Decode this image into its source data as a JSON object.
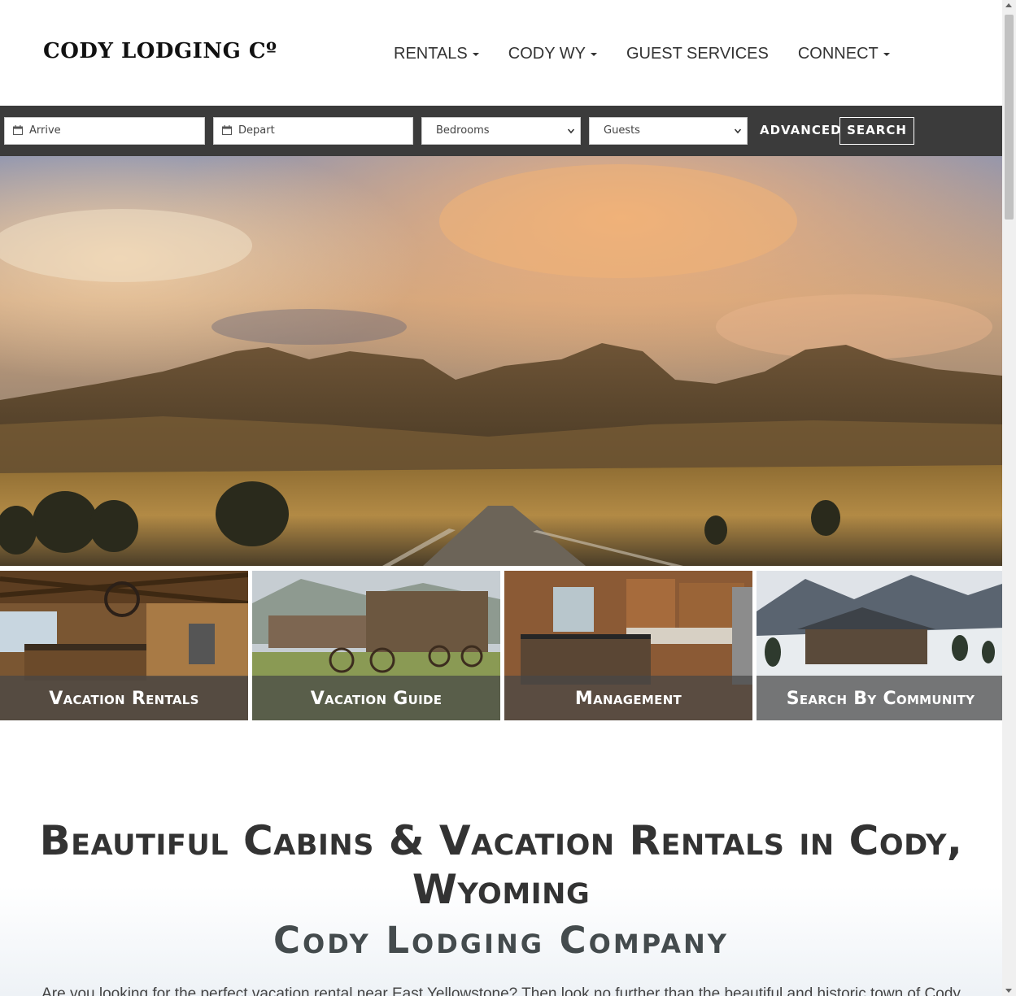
{
  "brand": {
    "logo_text": "CODY LODGING Cº"
  },
  "nav": {
    "items": [
      {
        "label": "RENTALS",
        "dropdown": true
      },
      {
        "label": "CODY WY",
        "dropdown": true
      },
      {
        "label": "GUEST SERVICES",
        "dropdown": false
      },
      {
        "label": "CONNECT",
        "dropdown": true
      }
    ]
  },
  "search": {
    "arrive_placeholder": "Arrive",
    "depart_placeholder": "Depart",
    "bedrooms_label": "Bedrooms",
    "guests_label": "Guests",
    "advanced_label": "ADVANCED",
    "search_label": "SEARCH"
  },
  "tiles": [
    {
      "label": "Vacation Rentals"
    },
    {
      "label": "Vacation Guide"
    },
    {
      "label": "Management"
    },
    {
      "label": "Search By Community"
    }
  ],
  "main": {
    "headline_line1": "Beautiful Cabins & Vacation Rentals in Cody,",
    "headline_line2": "Wyoming",
    "subheading": "Cody Lodging Company",
    "intro_text": "Are you looking for the perfect vacation rental near East Yellowstone? Then look no further than the beautiful and historic town of Cody"
  },
  "colors": {
    "searchbar_bg": "#3b3b3b",
    "tile_overlay": "#464646",
    "headline": "#333333"
  }
}
